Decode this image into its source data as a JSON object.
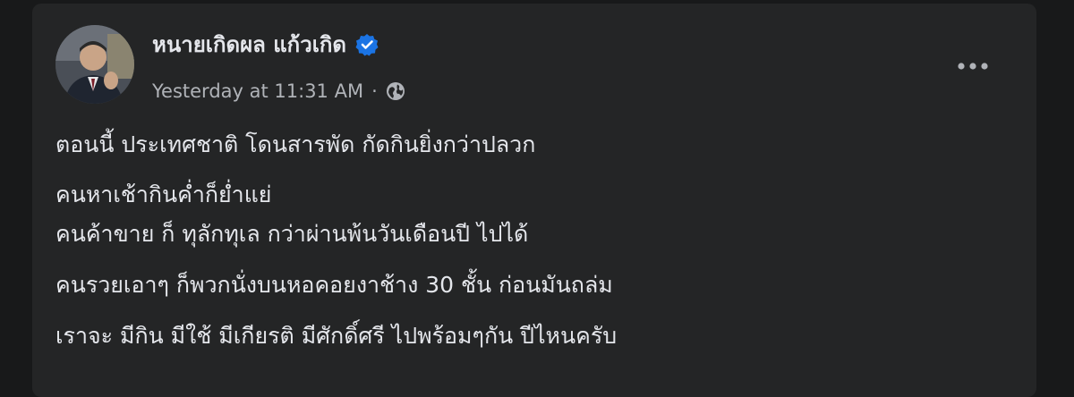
{
  "post": {
    "author_name": "หนายเกิดผล แก้วเกิด",
    "timestamp": "Yesterday at 11:31 AM",
    "separator": "·",
    "privacy_icon": "globe-icon",
    "verified_icon": "verified-badge-icon",
    "more_icon": "more-options-icon",
    "lines": [
      "ตอนนี้ ประเทศชาติ โดนสารพัด กัดกินยิ่งกว่าปลวก",
      "คนหาเช้ากินค่ำก็ย่ำแย่",
      "คนค้าขาย ก็ ทุลักทุเล กว่าผ่านพ้นวันเดือนปี ไปได้",
      "คนรวยเอาๆ ก็พวกนั่งบนหอคอยงาช้าง 30 ชั้น ก่อนมันถล่ม",
      "เราจะ มีกิน มีใช้ มีเกียรติ มีศักดิ์ศรี ไปพร้อมๆกัน  ปีไหนครับ"
    ]
  },
  "colors": {
    "background": "#18191a",
    "card": "#242526",
    "primary_text": "#e4e6eb",
    "secondary_text": "#b0b3b8",
    "verified_blue": "#1b74e4"
  }
}
